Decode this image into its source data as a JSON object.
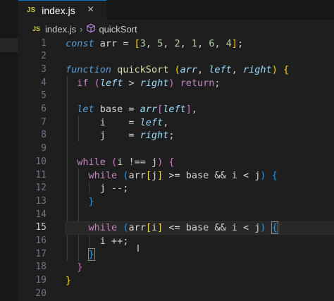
{
  "tab": {
    "icon": "JS",
    "title": "index.js",
    "close": "×"
  },
  "breadcrumb": {
    "icon": "JS",
    "file": "index.js",
    "separator": "›",
    "symbol_icon": "cube-symbol-icon",
    "symbol": "quickSort"
  },
  "editor": {
    "current_line": 15,
    "lines": [
      {
        "n": "1",
        "tokens": [
          [
            "k",
            "const"
          ],
          [
            "v",
            " arr = "
          ],
          [
            "b1",
            "["
          ],
          [
            "n",
            "3"
          ],
          [
            "v",
            ", "
          ],
          [
            "n",
            "5"
          ],
          [
            "v",
            ", "
          ],
          [
            "n",
            "2"
          ],
          [
            "v",
            ", "
          ],
          [
            "n",
            "1"
          ],
          [
            "v",
            ", "
          ],
          [
            "n",
            "6"
          ],
          [
            "v",
            ", "
          ],
          [
            "n",
            "4"
          ],
          [
            "b1",
            "]"
          ],
          [
            "v",
            ";"
          ]
        ]
      },
      {
        "n": "2",
        "tokens": []
      },
      {
        "n": "3",
        "tokens": [
          [
            "k",
            "function"
          ],
          [
            "v",
            " "
          ],
          [
            "f",
            "quickSort"
          ],
          [
            "v",
            " "
          ],
          [
            "b1",
            "("
          ],
          [
            "p",
            "arr"
          ],
          [
            "v",
            ", "
          ],
          [
            "p",
            "left"
          ],
          [
            "v",
            ", "
          ],
          [
            "p",
            "right"
          ],
          [
            "b1",
            ")"
          ],
          [
            "v",
            " "
          ],
          [
            "b1",
            "{"
          ]
        ]
      },
      {
        "n": "4",
        "tokens": [
          [
            "v",
            "  "
          ],
          [
            "kc",
            "if"
          ],
          [
            "v",
            " "
          ],
          [
            "b2",
            "("
          ],
          [
            "p",
            "left"
          ],
          [
            "v",
            " > "
          ],
          [
            "p",
            "right"
          ],
          [
            "b2",
            ")"
          ],
          [
            "v",
            " "
          ],
          [
            "kc",
            "return"
          ],
          [
            "v",
            ";"
          ]
        ]
      },
      {
        "n": "5",
        "tokens": []
      },
      {
        "n": "6",
        "tokens": [
          [
            "v",
            "  "
          ],
          [
            "k",
            "let"
          ],
          [
            "v",
            " base = "
          ],
          [
            "p",
            "arr"
          ],
          [
            "b2",
            "["
          ],
          [
            "p",
            "left"
          ],
          [
            "b2",
            "]"
          ],
          [
            "v",
            ","
          ]
        ]
      },
      {
        "n": "7",
        "tokens": [
          [
            "v",
            "      i    = "
          ],
          [
            "p",
            "left"
          ],
          [
            "v",
            ","
          ]
        ]
      },
      {
        "n": "8",
        "tokens": [
          [
            "v",
            "      j    = "
          ],
          [
            "p",
            "right"
          ],
          [
            "v",
            ";"
          ]
        ]
      },
      {
        "n": "9",
        "tokens": []
      },
      {
        "n": "10",
        "tokens": [
          [
            "v",
            "  "
          ],
          [
            "kc",
            "while"
          ],
          [
            "v",
            " "
          ],
          [
            "b2",
            "("
          ],
          [
            "v",
            "i !== j"
          ],
          [
            "b2",
            ")"
          ],
          [
            "v",
            " "
          ],
          [
            "b2",
            "{"
          ]
        ]
      },
      {
        "n": "11",
        "tokens": [
          [
            "v",
            "    "
          ],
          [
            "kc",
            "while"
          ],
          [
            "v",
            " "
          ],
          [
            "b3",
            "("
          ],
          [
            "v",
            "arr"
          ],
          [
            "b1",
            "["
          ],
          [
            "v",
            "j"
          ],
          [
            "b1",
            "]"
          ],
          [
            "v",
            " >= base && i < j"
          ],
          [
            "b3",
            ")"
          ],
          [
            "v",
            " "
          ],
          [
            "b3",
            "{"
          ]
        ]
      },
      {
        "n": "12",
        "tokens": [
          [
            "v",
            "      j --;"
          ]
        ]
      },
      {
        "n": "13",
        "tokens": [
          [
            "v",
            "    "
          ],
          [
            "b3",
            "}"
          ]
        ]
      },
      {
        "n": "14",
        "tokens": []
      },
      {
        "n": "15",
        "tokens": [
          [
            "v",
            "    "
          ],
          [
            "kc",
            "while"
          ],
          [
            "v",
            " "
          ],
          [
            "b3",
            "("
          ],
          [
            "v",
            "arr"
          ],
          [
            "b1",
            "["
          ],
          [
            "v",
            "i"
          ],
          [
            "b1",
            "]"
          ],
          [
            "v",
            " <= base && i < j"
          ],
          [
            "b3",
            ")"
          ],
          [
            "v",
            " "
          ],
          [
            "b3 bm",
            "{"
          ]
        ]
      },
      {
        "n": "16",
        "tokens": [
          [
            "v",
            "      i ++;"
          ]
        ]
      },
      {
        "n": "17",
        "tokens": [
          [
            "v",
            "    "
          ],
          [
            "b3 bm",
            "}"
          ]
        ]
      },
      {
        "n": "18",
        "tokens": [
          [
            "v",
            "  "
          ],
          [
            "b2",
            "}"
          ]
        ]
      },
      {
        "n": "19",
        "tokens": [
          [
            "b1",
            "}"
          ]
        ]
      },
      {
        "n": "20",
        "tokens": []
      }
    ]
  },
  "colors": {
    "background": "#1e1e1e",
    "keyword": "#569cd6",
    "control": "#c586c0",
    "function": "#dcdcaa",
    "param": "#9cdcfe",
    "number": "#b5cea8"
  }
}
